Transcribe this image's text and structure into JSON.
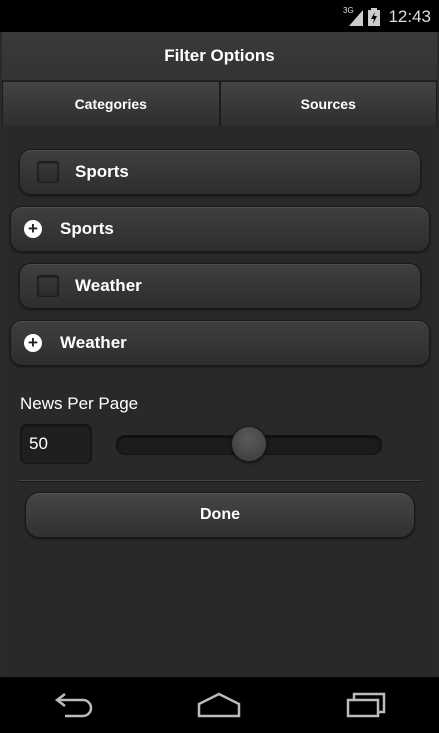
{
  "status_bar": {
    "network": "3G",
    "time": "12:43",
    "icons": [
      "network-3g-icon",
      "signal-icon",
      "battery-charging-icon"
    ]
  },
  "header": {
    "title": "Filter Options"
  },
  "tabs": [
    {
      "label": "Categories"
    },
    {
      "label": "Sources"
    }
  ],
  "filters": [
    {
      "type": "checkbox",
      "label": "Sports",
      "checked": false
    },
    {
      "type": "expand",
      "label": "Sports",
      "icon": "plus-icon"
    },
    {
      "type": "checkbox",
      "label": "Weather",
      "checked": false
    },
    {
      "type": "expand",
      "label": "Weather",
      "icon": "plus-icon"
    }
  ],
  "news_per_page": {
    "label": "News Per Page",
    "value": "50",
    "slider_fraction": 0.5
  },
  "done_button": {
    "label": "Done"
  },
  "nav": {
    "icons": [
      "back-icon",
      "home-icon",
      "recent-apps-icon"
    ]
  }
}
